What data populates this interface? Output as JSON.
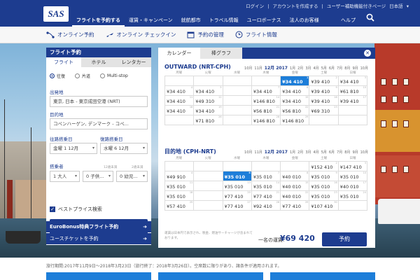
{
  "header": {
    "logo": "SAS",
    "top_links": [
      "ログイン",
      "|",
      "アカウントを作成する",
      "|",
      "ユーザー補助機能付きページ",
      "日本語",
      "▾"
    ],
    "nav": [
      "フライトを予約する",
      "運賃・キャンペーン",
      "就航都市",
      "トラベル情報",
      "ユーロボーナス",
      "法人のお客様"
    ],
    "help": "ヘルプ"
  },
  "subnav": [
    {
      "label": "オンライン予約",
      "icon": "plane-network-icon"
    },
    {
      "label": "オンライン チェックイン",
      "icon": "checkin-plane-icon"
    },
    {
      "label": "予約の管理",
      "icon": "calendar-icon"
    },
    {
      "label": "フライト情報",
      "icon": "clock-icon"
    }
  ],
  "booking": {
    "title": "フライト予約",
    "tabs": [
      "フライト",
      "ホテル",
      "レンタカー"
    ],
    "trip_types": [
      "往復",
      "片道",
      "Multi-stop"
    ],
    "origin_label": "出発地",
    "origin_value": "東京, 日本 - 東京成田空港 (NRT)",
    "dest_label": "目的地",
    "dest_value": "コペンハーゲン, デンマーク - コペ...",
    "depart_label": "往路搭乗日",
    "depart_value": "金曜 1 12月",
    "return_label": "復路搭乗日",
    "return_value": "水曜 6 12月",
    "pax_label": "搭乗者",
    "pax_sub": [
      "",
      "12歳未満",
      "2歳未満"
    ],
    "pax_values": [
      "1 大人",
      "0 子供...",
      "0 幼児..."
    ],
    "best_price": "ベストプライス検索",
    "search_button": "検索",
    "link1": "EuroBonus特典フライト予約",
    "link2": "ユースチケットを予約"
  },
  "calendar": {
    "tabs": [
      "カレンダー",
      "棒グラフ"
    ],
    "dow": [
      "月曜",
      "火曜",
      "水曜",
      "木曜",
      "金曜",
      "土曜",
      "日曜"
    ],
    "outbound": {
      "title": "OUTWARD (NRT-CPH)",
      "months": [
        "10月",
        "11月",
        "12月 2017",
        "1月",
        "2月",
        "3月",
        "4月",
        "5月",
        "6月",
        "7月",
        "8月",
        "9月",
        "10月"
      ],
      "selected_month_index": 2,
      "rows": [
        [
          {
            "p": ""
          },
          {
            "p": ""
          },
          {
            "p": ""
          },
          {
            "p": ""
          },
          {
            "p": "¥34 410",
            "d": "1",
            "hl": true
          },
          {
            "p": "¥39 410",
            "d": "2"
          },
          {
            "p": "¥34 410",
            "d": "3"
          }
        ],
        [
          {
            "p": "¥34 410",
            "d": "4"
          },
          {
            "p": "¥34 410",
            "d": "5"
          },
          {
            "p": ""
          },
          {
            "p": "¥34 410",
            "d": "7"
          },
          {
            "p": "¥34 410",
            "d": "8"
          },
          {
            "p": "¥39 410",
            "d": "9"
          },
          {
            "p": "¥61 810",
            "d": "10"
          }
        ],
        [
          {
            "p": "¥34 410",
            "d": "11"
          },
          {
            "p": "¥49 310",
            "d": "12"
          },
          {
            "p": ""
          },
          {
            "p": "¥146 810",
            "d": "14"
          },
          {
            "p": "¥34 410",
            "d": "15"
          },
          {
            "p": "¥39 410",
            "d": "16"
          },
          {
            "p": "¥39 410",
            "d": "17"
          }
        ],
        [
          {
            "p": "¥34 410",
            "d": "18"
          },
          {
            "p": "¥34 410",
            "d": "19"
          },
          {
            "p": ""
          },
          {
            "p": "¥56 810",
            "d": "21"
          },
          {
            "p": "¥56 810",
            "d": "22"
          },
          {
            "p": "¥69 310",
            "d": "23"
          },
          {
            "p": ""
          }
        ],
        [
          {
            "p": ""
          },
          {
            "p": "¥71 810",
            "d": "26"
          },
          {
            "p": ""
          },
          {
            "p": "¥146 810",
            "d": "28"
          },
          {
            "p": "¥146 810",
            "d": "29"
          },
          {
            "p": ""
          },
          {
            "p": ""
          }
        ]
      ]
    },
    "inbound": {
      "title": "目的地 (CPH-NRT)",
      "months": [
        "10月",
        "11月",
        "12月 2017",
        "1月",
        "2月",
        "3月",
        "4月",
        "5月",
        "6月",
        "7月",
        "8月",
        "9月",
        "10月"
      ],
      "selected_month_index": 2,
      "rows": [
        [
          {
            "p": ""
          },
          {
            "p": ""
          },
          {
            "p": ""
          },
          {
            "p": ""
          },
          {
            "p": ""
          },
          {
            "p": "¥152 410",
            "d": "2"
          },
          {
            "p": "¥147 410",
            "d": "3"
          }
        ],
        [
          {
            "p": "¥49 910",
            "d": "4"
          },
          {
            "p": ""
          },
          {
            "p": "¥35 010",
            "d": "6",
            "hl": true
          },
          {
            "p": "¥35 010",
            "d": "7"
          },
          {
            "p": "¥40 010",
            "d": "8"
          },
          {
            "p": "¥35 010",
            "d": "9"
          },
          {
            "p": "¥35 010",
            "d": "10"
          }
        ],
        [
          {
            "p": "¥35 010",
            "d": "11"
          },
          {
            "p": ""
          },
          {
            "p": "¥35 010",
            "d": "13"
          },
          {
            "p": "¥35 010",
            "d": "14"
          },
          {
            "p": "¥40 010",
            "d": "15"
          },
          {
            "p": "¥35 010",
            "d": "16"
          },
          {
            "p": "¥40 010",
            "d": "17"
          }
        ],
        [
          {
            "p": "¥35 010",
            "d": "18"
          },
          {
            "p": ""
          },
          {
            "p": "¥77 410",
            "d": "20"
          },
          {
            "p": "¥77 410",
            "d": "21"
          },
          {
            "p": "¥40 010",
            "d": "22"
          },
          {
            "p": "¥35 010",
            "d": "23"
          },
          {
            "p": "¥35 010",
            "d": "24"
          }
        ],
        [
          {
            "p": "¥57 410",
            "d": "25"
          },
          {
            "p": ""
          },
          {
            "p": "¥77 410",
            "d": "27"
          },
          {
            "p": "¥92 410",
            "d": "28"
          },
          {
            "p": "¥77 410",
            "d": "29"
          },
          {
            "p": "¥107 410",
            "d": "30"
          },
          {
            "p": ""
          }
        ]
      ]
    },
    "footnote": "運賃は日本円で表示され、税金、燃油サーチャージが含まれております。",
    "fare_label": "一名の運賃:",
    "fare_value": "¥69 420",
    "book_button": "予約"
  },
  "bottom_note": "旅行期間:2017年11月9日〜2018年3月23日（旅行終了：2018年3月26日）。空席数に限りがあり、諸条件が適用されます。",
  "colors": {
    "brand": "#1d3c8f",
    "highlight": "#1d7ed9"
  }
}
